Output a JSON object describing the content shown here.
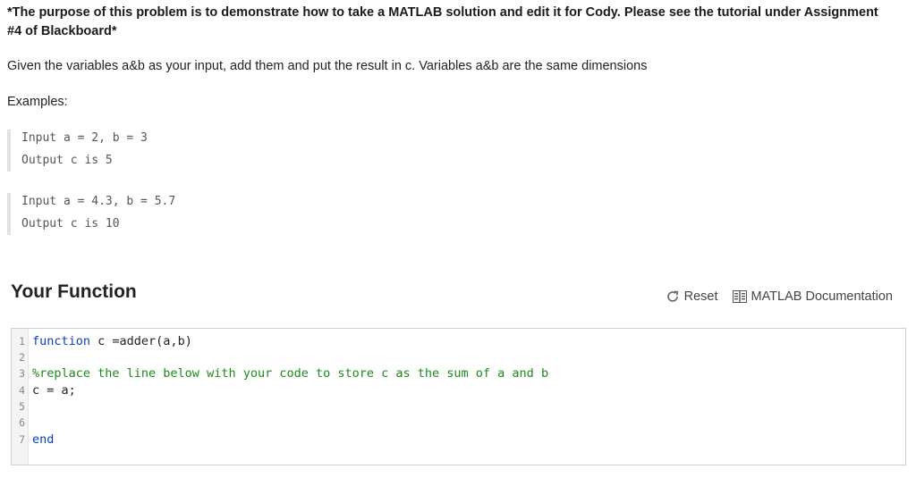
{
  "problem": {
    "intro": "*The purpose of this problem is to demonstrate how to take a MATLAB solution and edit it for Cody. Please see the tutorial under Assignment #4 of Blackboard*",
    "description": "Given the variables a&b as your input, add them and put the result in c. Variables a&b are the same dimensions",
    "examples_label": "Examples:",
    "examples": [
      {
        "input": "Input a = 2, b = 3",
        "output": "Output c is 5"
      },
      {
        "input": "Input a = 4.3, b = 5.7",
        "output": "Output c is 10"
      }
    ]
  },
  "function_section": {
    "title": "Your Function",
    "reset_label": "Reset",
    "docs_label": "MATLAB Documentation"
  },
  "editor": {
    "line_numbers": [
      "1",
      "2",
      "3",
      "4",
      "5",
      "6",
      "7"
    ],
    "line1_kw": "function",
    "line1_rest": " c =adder(a,b)",
    "line3_comment": "%replace the line below with your code to store c as the sum of a and b",
    "line4": "c = a;",
    "line7_kw": "end"
  },
  "colors": {
    "keyword": "#0a3ec8",
    "comment": "#1a8a1a"
  }
}
